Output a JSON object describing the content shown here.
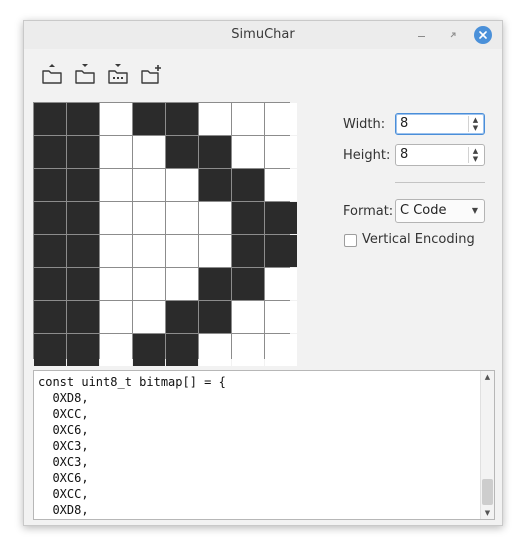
{
  "window": {
    "title": "SimuChar",
    "controls": {
      "minimize_icon": "minimize-icon",
      "restore_icon": "restore-icon",
      "close_icon": "close-icon"
    }
  },
  "toolbar": {
    "buttons": [
      {
        "icon": "folder-upload-icon"
      },
      {
        "icon": "folder-download-icon"
      },
      {
        "icon": "import-icon"
      },
      {
        "icon": "new-folder-icon"
      }
    ]
  },
  "bitmap": {
    "rows": [
      [
        1,
        1,
        0,
        1,
        1,
        0,
        0,
        0
      ],
      [
        1,
        1,
        0,
        0,
        1,
        1,
        0,
        0
      ],
      [
        1,
        1,
        0,
        0,
        0,
        1,
        1,
        0
      ],
      [
        1,
        1,
        0,
        0,
        0,
        0,
        1,
        1
      ],
      [
        1,
        1,
        0,
        0,
        0,
        0,
        1,
        1
      ],
      [
        1,
        1,
        0,
        0,
        0,
        1,
        1,
        0
      ],
      [
        1,
        1,
        0,
        0,
        1,
        1,
        0,
        0
      ],
      [
        1,
        1,
        0,
        1,
        1,
        0,
        0,
        0
      ]
    ],
    "on_color": "#2b2b2b",
    "off_color": "#ffffff"
  },
  "settings": {
    "width_label": "Width:",
    "width_value": "8",
    "height_label": "Height:",
    "height_value": "8",
    "format_label": "Format:",
    "format_value": "C Code",
    "vertical_encoding_label": "Vertical Encoding",
    "vertical_encoding_checked": false
  },
  "output": {
    "code": "const uint8_t bitmap[] = {\n  0XD8,\n  0XCC,\n  0XC6,\n  0XC3,\n  0XC3,\n  0XC6,\n  0XCC,\n  0XD8,"
  },
  "colors": {
    "accent": "#4a90d9",
    "window_bg": "#f2f2f2"
  }
}
